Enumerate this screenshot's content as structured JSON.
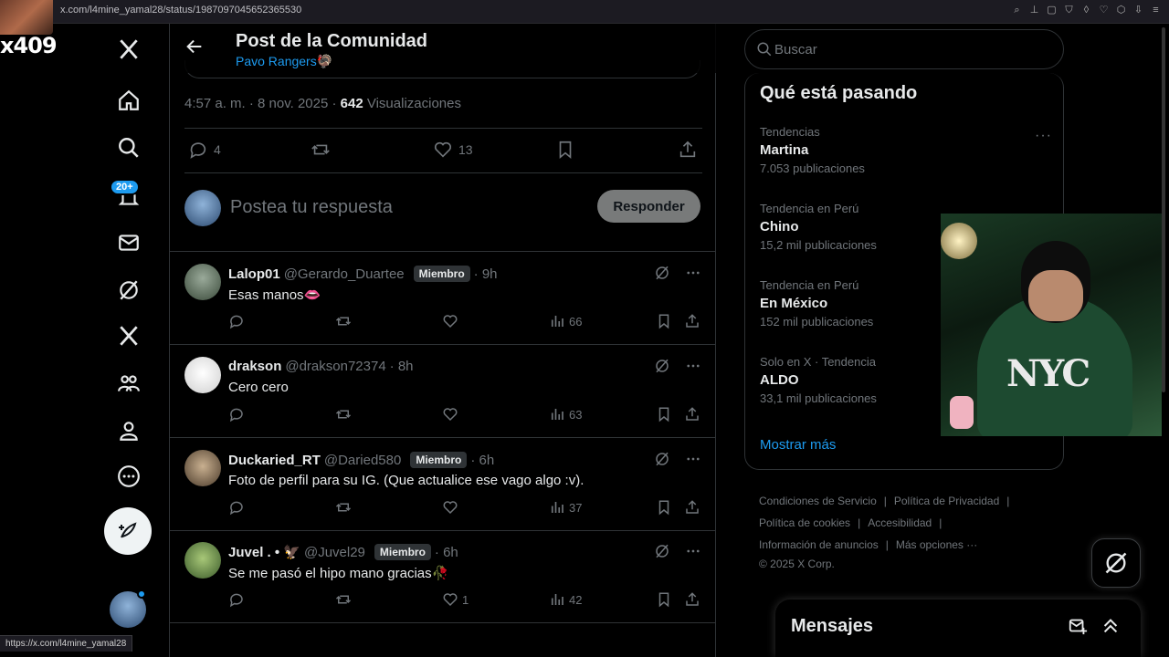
{
  "browser": {
    "url": "x.com/l4mine_yamal28/status/1987097045652365530"
  },
  "overlay_tag": "x409",
  "nav": {
    "badge": "20+"
  },
  "header": {
    "title": "Post de la Comunidad",
    "community": "Pavo Rangers🦃"
  },
  "post": {
    "time": "4:57 a. m. · 8 nov. 2025 · ",
    "views": "642",
    "views_label": " Visualizaciones",
    "replies": "4",
    "likes": "13"
  },
  "reply_box": {
    "placeholder": "Postea tu respuesta",
    "button": "Responder"
  },
  "replies": [
    {
      "name": "Lalop01",
      "handle": "@Gerardo_Duartee",
      "badge": "Miembro",
      "time": "· 9h",
      "text": "Esas manos👄",
      "likes": "",
      "views": "66",
      "avatar": "#4a5a4a"
    },
    {
      "name": "drakson",
      "handle": "@drakson72374",
      "badge": "",
      "time": "· 8h",
      "text": "Cero cero",
      "likes": "",
      "views": "63",
      "avatar": "#e8e8e8"
    },
    {
      "name": "Duckaried_RT",
      "handle": "@Daried580",
      "badge": "Miembro",
      "time": "· 6h",
      "text": "Foto de perfil para su IG. (Que actualice ese vago algo :v).",
      "likes": "",
      "views": "37",
      "avatar": "#7a6a58"
    },
    {
      "name": "Juvel . • 🦅",
      "handle": "@Juvel29",
      "badge": "Miembro",
      "time": "· 6h",
      "text": "Se me pasó el hipo mano gracias🥀",
      "likes": "1",
      "views": "42",
      "avatar": "#5a7a3a"
    }
  ],
  "search": {
    "placeholder": "Buscar"
  },
  "trends": {
    "title": "Qué está pasando",
    "items": [
      {
        "context": "Tendencias",
        "name": "Martina",
        "count": "7.053 publicaciones"
      },
      {
        "context": "Tendencia en Perú",
        "name": "Chino",
        "count": "15,2 mil publicaciones"
      },
      {
        "context": "Tendencia en Perú",
        "name": "En México",
        "count": "152 mil publicaciones"
      },
      {
        "context": "Solo en X · Tendencia",
        "name": "ALDO",
        "count": "33,1 mil publicaciones"
      }
    ],
    "show_more": "Mostrar más"
  },
  "footer": {
    "terms": "Condiciones de Servicio",
    "privacy": "Política de Privacidad",
    "cookies": "Política de cookies",
    "accessibility": "Accesibilidad",
    "ads": "Información de anuncios",
    "more": "Más opciones ···",
    "copyright": "© 2025 X Corp."
  },
  "messages": {
    "title": "Mensajes"
  },
  "webcam_text": "NYC",
  "status_url": "https://x.com/l4mine_yamal28"
}
